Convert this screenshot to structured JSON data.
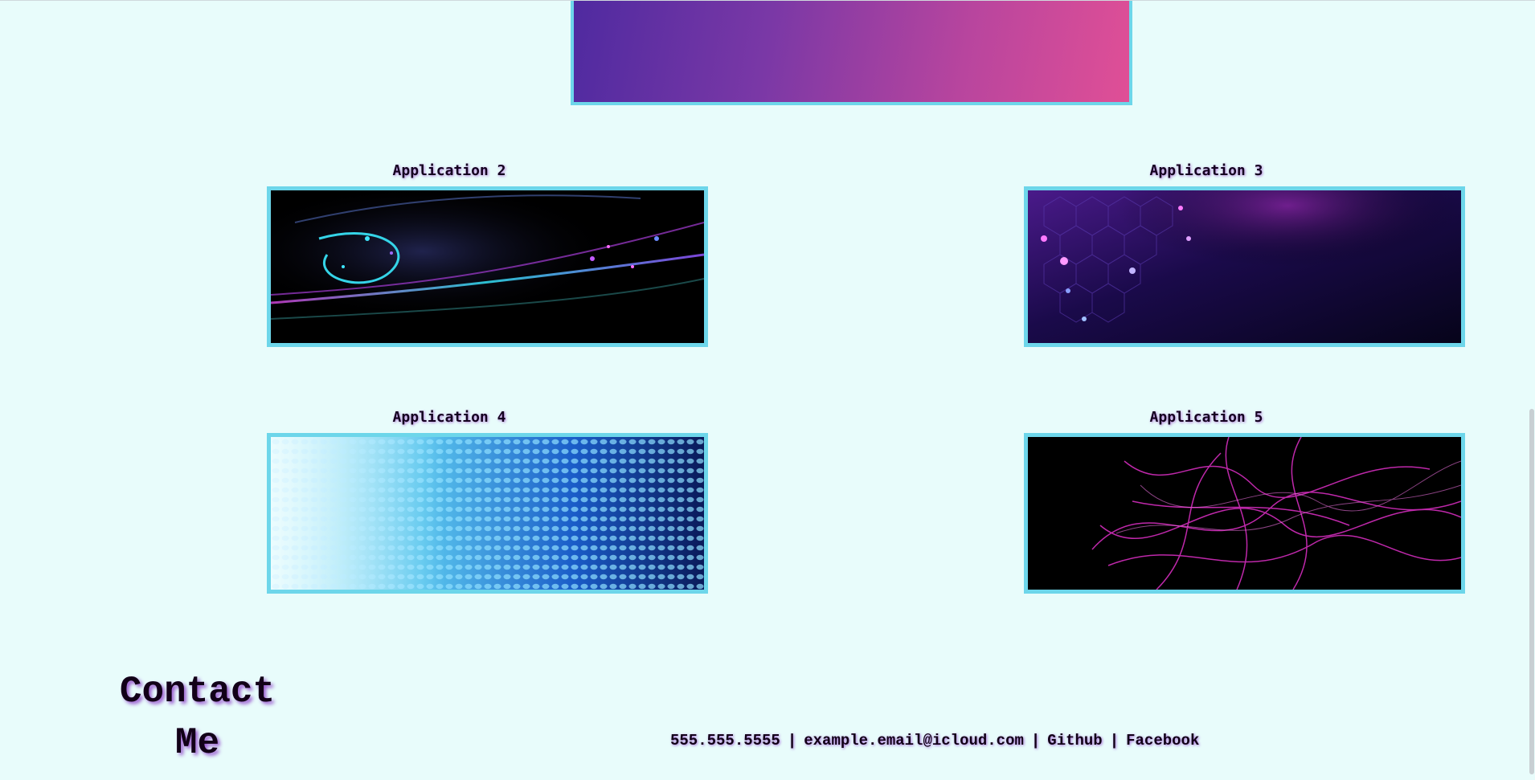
{
  "apps": [
    {
      "title": "Application 2"
    },
    {
      "title": "Application 3"
    },
    {
      "title": "Application 4"
    },
    {
      "title": "Application 5"
    }
  ],
  "contact": {
    "title_line1": "Contact",
    "title_line2": "Me",
    "phone": "555.555.5555",
    "email": "example.email@icloud.com",
    "github": "Github",
    "facebook": "Facebook",
    "separator": "|"
  },
  "colors": {
    "background": "#e8fcfb",
    "border": "#6dd6ea",
    "text": "#120018"
  }
}
